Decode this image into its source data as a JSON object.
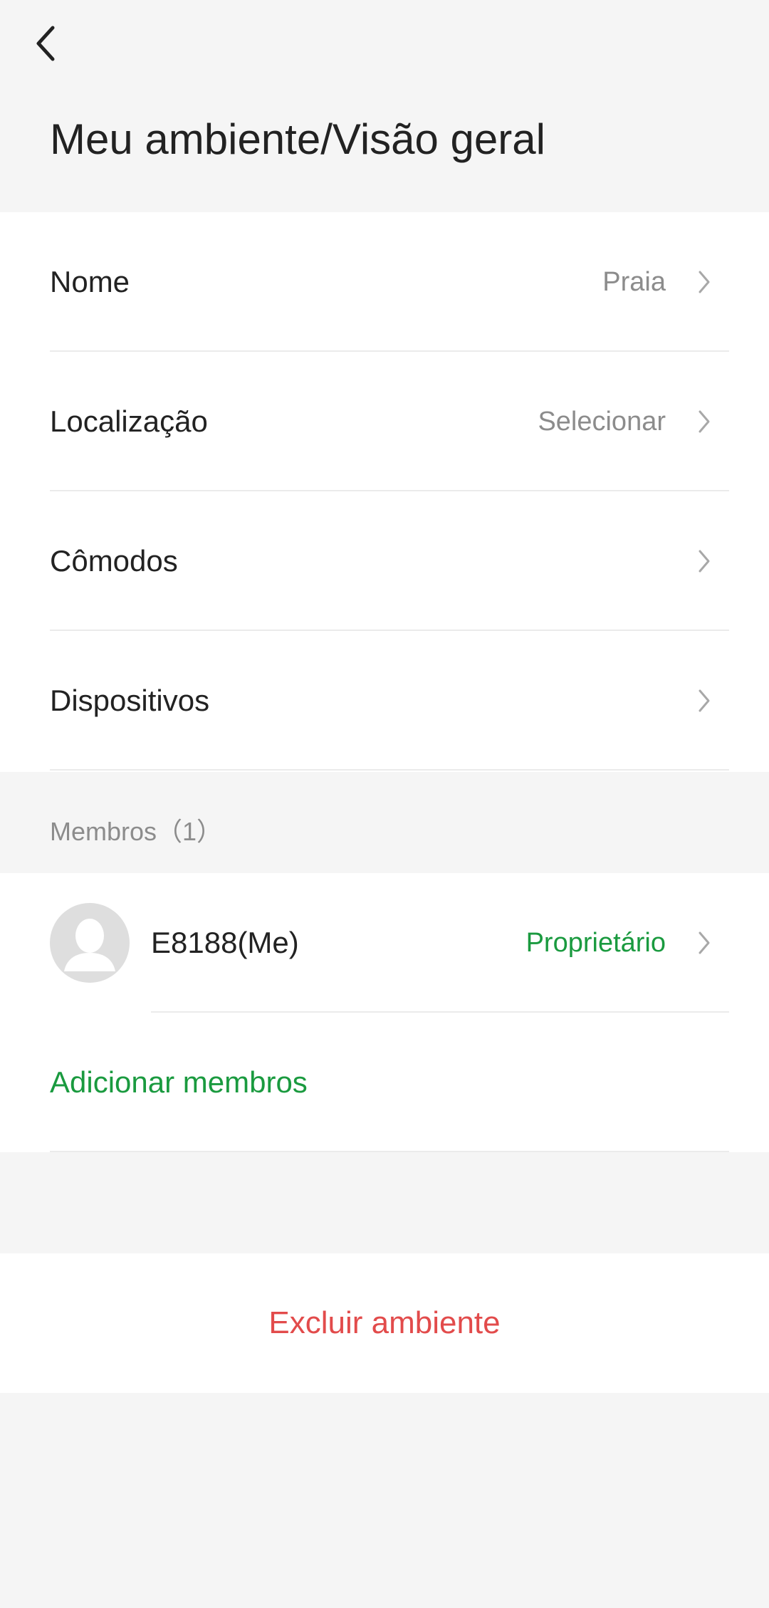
{
  "header": {
    "back_icon": "chevron-left-icon",
    "title": "Meu ambiente/Visão geral"
  },
  "settings": {
    "rows": [
      {
        "label": "Nome",
        "value": "Praia"
      },
      {
        "label": "Localização",
        "value": "Selecionar"
      },
      {
        "label": "Cômodos",
        "value": ""
      },
      {
        "label": "Dispositivos",
        "value": ""
      }
    ]
  },
  "members": {
    "section_label": "Membros（1）",
    "list": [
      {
        "name": "E8188(Me)",
        "role": "Proprietário",
        "avatar_icon": "person-avatar-icon"
      }
    ],
    "add_label": "Adicionar membros"
  },
  "actions": {
    "delete_label": "Excluir ambiente"
  },
  "colors": {
    "accent_green": "#1a9a3f",
    "danger_red": "#e24b4b",
    "background": "#f5f5f5",
    "secondary_text": "#8c8c8c"
  }
}
